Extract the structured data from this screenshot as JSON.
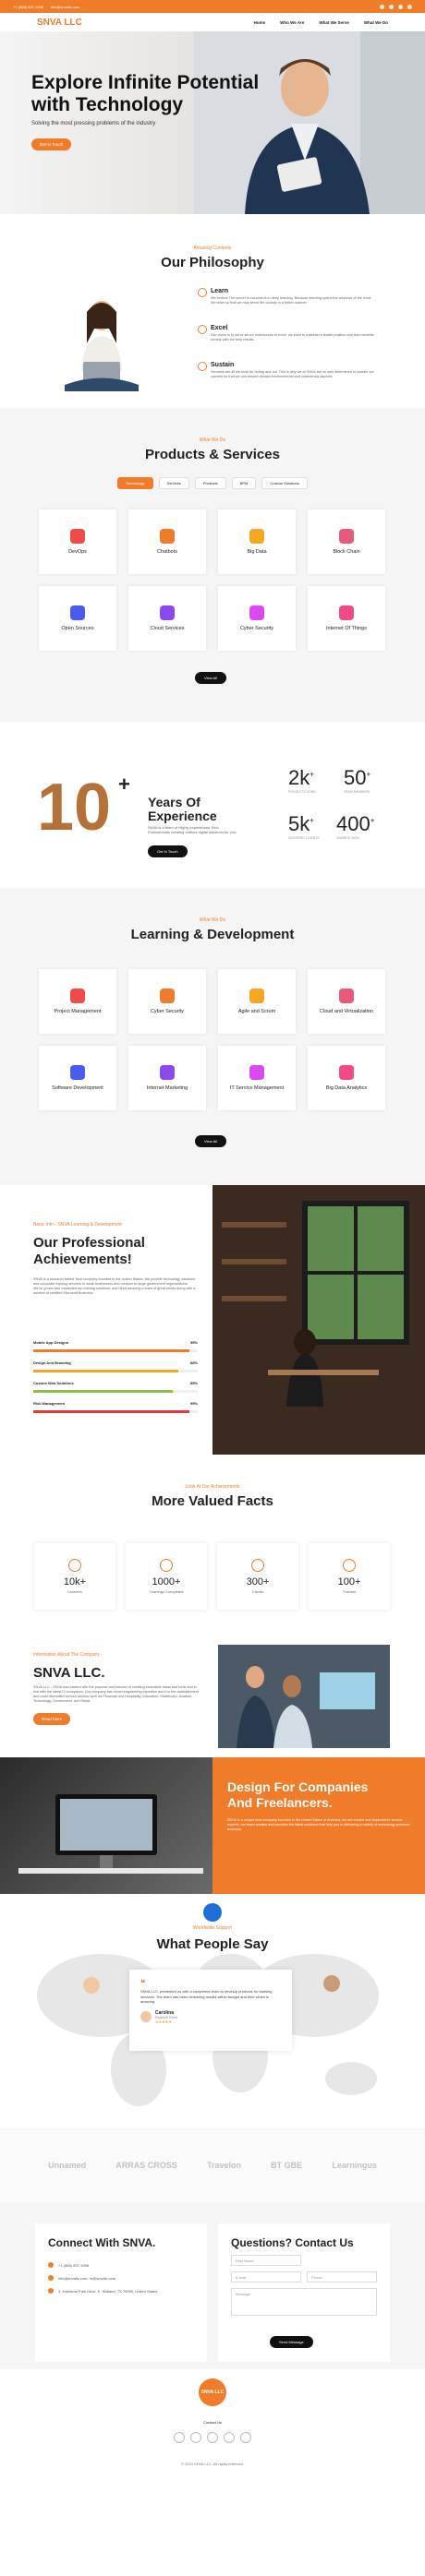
{
  "topbar": {
    "phone": "+1 (888) 837-1998",
    "email": "info@snvallc.com"
  },
  "nav": {
    "logo": "SNVA LLC",
    "items": [
      "Home",
      "Who We Are",
      "What We Serve",
      "What We Do"
    ]
  },
  "hero": {
    "title_line1": "Explore Infinite Potential",
    "title_line2": "with Technology",
    "subtitle": "Solving the most pressing problems of the industry",
    "cta": "Get in Touch"
  },
  "philosophy": {
    "kicker": "Amazing Contents",
    "title": "Our Philosophy",
    "items": [
      {
        "title": "Learn",
        "text": "We believe The secret to success is in deep learning. Because learning opens the windows of the mind. We learn so that we may serve the country in a better manner."
      },
      {
        "title": "Excel",
        "text": "Our vision is to serve all our endeavours to excel, we want to maintain a leader position and then benefits society with the best results."
      },
      {
        "title": "Sustain",
        "text": "Services are all we work for during and our. This is why we at SNVA are so well determined to sustain our courses so that we can ensure climate environmental and commercial aspects."
      }
    ]
  },
  "products": {
    "kicker": "What We Do",
    "title": "Products & Services",
    "tabs": [
      "Technology",
      "Services",
      "Products",
      "BPM",
      "Custom Solutions"
    ],
    "cards": [
      "DevOps",
      "Chatbots",
      "Big Data",
      "Block Chain",
      "Open Sources",
      "Cloud Services",
      "Cyber Security",
      "Internet Of Things"
    ],
    "view_all": "View All"
  },
  "experience": {
    "years": "10",
    "plus": "+",
    "title_line1": "Years Of",
    "title_line2": "Experience",
    "text": "SNVA is a team of Highly experienced Tech Professionals creating various digital solutions for you.",
    "cta": "Get In Touch",
    "stats": [
      {
        "n": "2k",
        "l": "PROJECTS DONE"
      },
      {
        "n": "50",
        "l": "TEAM MEMBERS"
      },
      {
        "n": "5k",
        "l": "SATISFIED CLIENTS"
      },
      {
        "n": "400",
        "l": "AWARDS WON"
      }
    ]
  },
  "learning": {
    "kicker": "What We Do",
    "title": "Learning & Development",
    "cards": [
      "Project Management",
      "Cyber Security",
      "Agile and Scrum",
      "Cloud and Virtualization",
      "Software Development",
      "Internet Marketing",
      "IT Service Management",
      "Big Data Analytics"
    ],
    "view_all": "View All"
  },
  "about": {
    "kicker": "Basic Info - SNVA Learning & Development",
    "title_line1": "Our Professional",
    "title_line2": "Achievements!",
    "text": "SNVA is a research based Tech company founded in the United States. We provide technology solutions and corporate training services to small businesses and medium to large government organizations. We've grown and expanded our training solutions, and hired amazing a team of great minds along with a number of certified Microsoft Business.",
    "skills": [
      {
        "name": "Mobile App Designs",
        "pct": "95%",
        "value": 0.95
      },
      {
        "name": "Design And Branding",
        "pct": "88%",
        "value": 0.88
      },
      {
        "name": "Custom Web Solutions",
        "pct": "85%",
        "value": 0.85
      },
      {
        "name": "Risk Management",
        "pct": "95%",
        "value": 0.95
      }
    ]
  },
  "facts": {
    "kicker": "Look At Our Achievements",
    "title": "More Valued Facts",
    "items": [
      {
        "n": "10k+",
        "l": "Learners"
      },
      {
        "n": "1000+",
        "l": "Trainings Completed"
      },
      {
        "n": "300+",
        "l": "Clients"
      },
      {
        "n": "100+",
        "l": "Trainers"
      }
    ]
  },
  "company": {
    "kicker": "Information About The Company",
    "title": "SNVA LLC.",
    "text": "SNVA LLC - SNVA was started with the purpose and mission of creating innovative ideas and tools and in line with the latest IT ecosystem. Our company has broad engineering expertise and it is the establishment and most diversified service sectors such as Financial and Hospitality, Education, Healthcare, Aviation, Technology, Government, and Retail.",
    "cta": "Read More"
  },
  "design": {
    "title_line1": "Design For Companies",
    "title_line2": "And Freelancers.",
    "text": "SNVA is a unique tech company founded in the United States of America, we are trusted and dependable service experts, our team creates and provides the latest solutions that help you in delivering a variety of technology-powered business."
  },
  "testimonials": {
    "kicker": "Worldwide Support",
    "title": "What People Say",
    "quote": "SNVA LLC, presented us with a competent team to develop products for banking services. The team has been delivering results within budget and time which is amazing.",
    "name": "Carolina",
    "role": "Regional Client"
  },
  "clients": [
    "Unnamed",
    "ARRAS CROSS",
    "Travelon",
    "BT GBE",
    "Learningus"
  ],
  "contact": {
    "title": "Connect With SNVA.",
    "phone": "+1 (888) 837-1998",
    "email": "info@snvallc.com; hr@snvallc.com",
    "address": "3, Industrial Park Drive, E. Midland, TX 75990, United States",
    "form_title": "Questions? Contact Us",
    "fields": [
      "First Name",
      "E-mail",
      "Phone",
      "Message"
    ],
    "submit": "Send Message"
  },
  "footer": {
    "logo": "SNVA LLC",
    "contact_us": "Contact Us",
    "copyright": "© 2023 SNVA LLC. All rights reserved."
  }
}
